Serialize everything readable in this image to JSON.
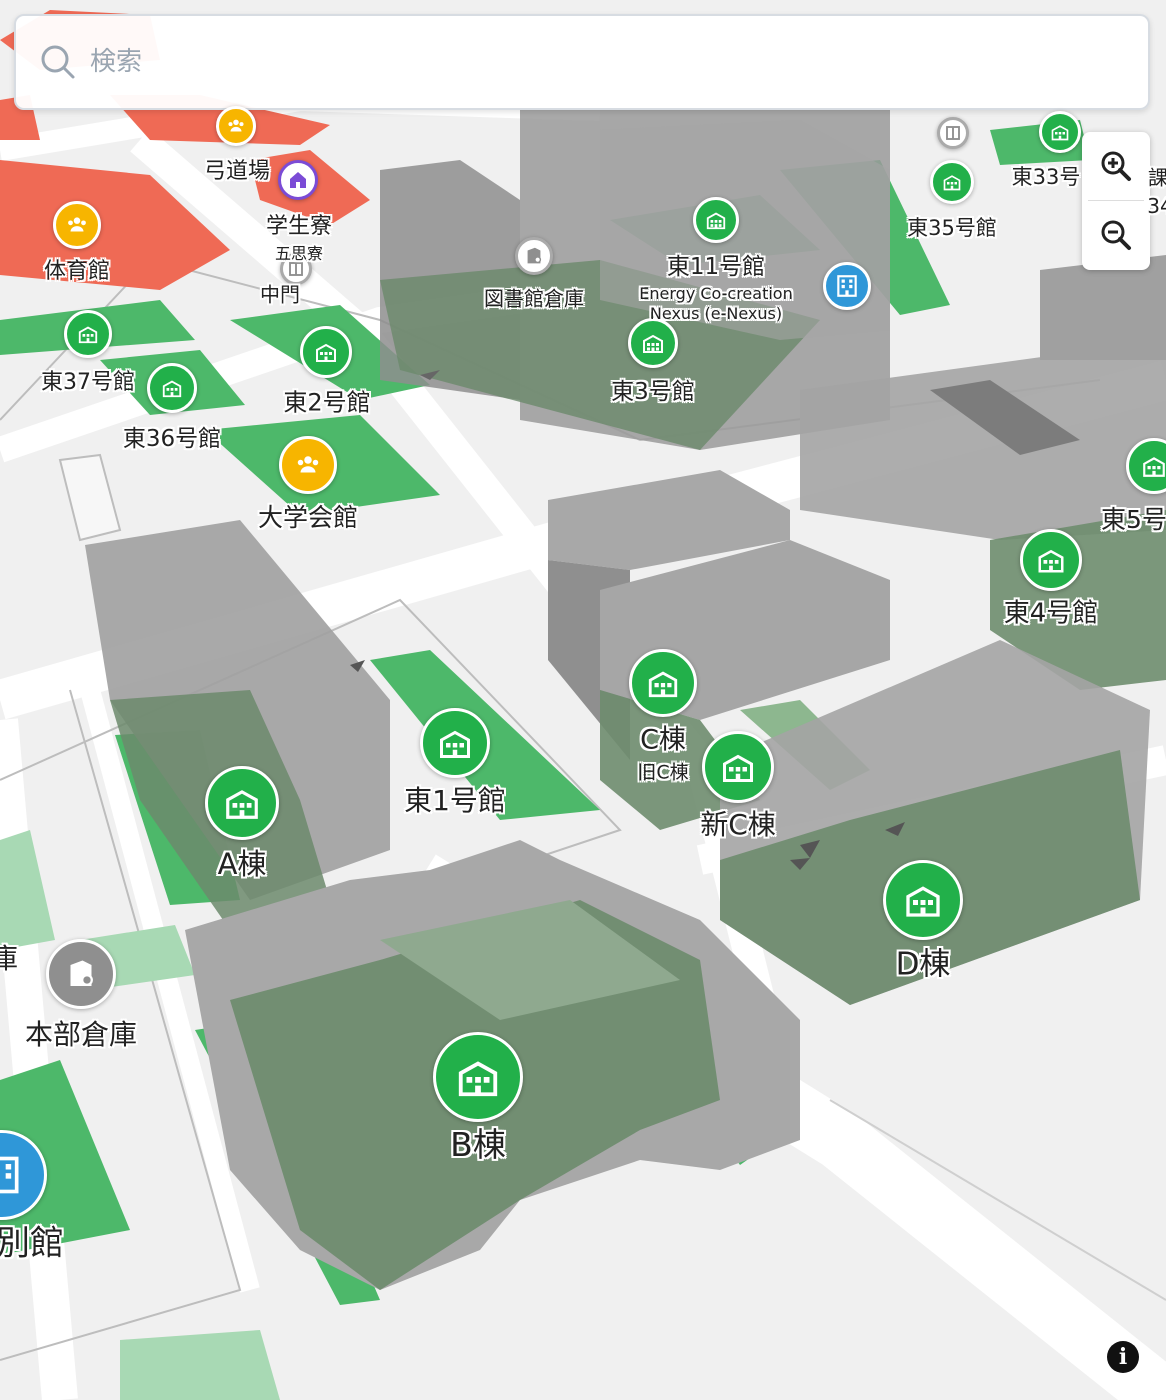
{
  "search": {
    "placeholder": "検索"
  },
  "colors": {
    "building_green": "#4db86a",
    "pin_green": "#22b04a",
    "sports_red": "#ef6a55",
    "facility_yellow": "#f7b500",
    "info_blue": "#2f97d8",
    "storage_grey": "#8f8f8f",
    "dorm_purple": "#7b4bd6",
    "road": "#ffffff",
    "block_grey": "#9c9c9c"
  },
  "labels": {
    "kyudojo": "弓道場",
    "gakuseiryo": "学生寮",
    "gosiryo": "五思寮",
    "chumon": "中門",
    "taiikukan": "体育館",
    "tosho_souko": "図書館倉庫",
    "higashi11": "東11号館",
    "enexus": "Energy Co-creation Nexus (e-Nexus)",
    "higashi3": "東3号館",
    "higashi33": "東33号",
    "higashi35": "東35号館",
    "higashi37": "東37号館",
    "higashi36": "東36号館",
    "higashi2": "東2号館",
    "daigaku_kaikan": "大学会館",
    "higashi5": "東5号",
    "higashi4": "東4号館",
    "c_tou": "C棟",
    "kyu_c_tou": "旧C棟",
    "shin_c_tou": "新C棟",
    "higashi1": "東1号館",
    "a_tou": "A棟",
    "d_tou": "D棟",
    "honbu_souko": "本部倉庫",
    "b_tou": "B棟",
    "bekkan": "別館",
    "edge_34": "34",
    "edge_ka": "課",
    "edge_ko": "庫"
  },
  "controls": {
    "zoom_in": "zoom-in-icon",
    "zoom_out": "zoom-out-icon",
    "info": "i"
  }
}
